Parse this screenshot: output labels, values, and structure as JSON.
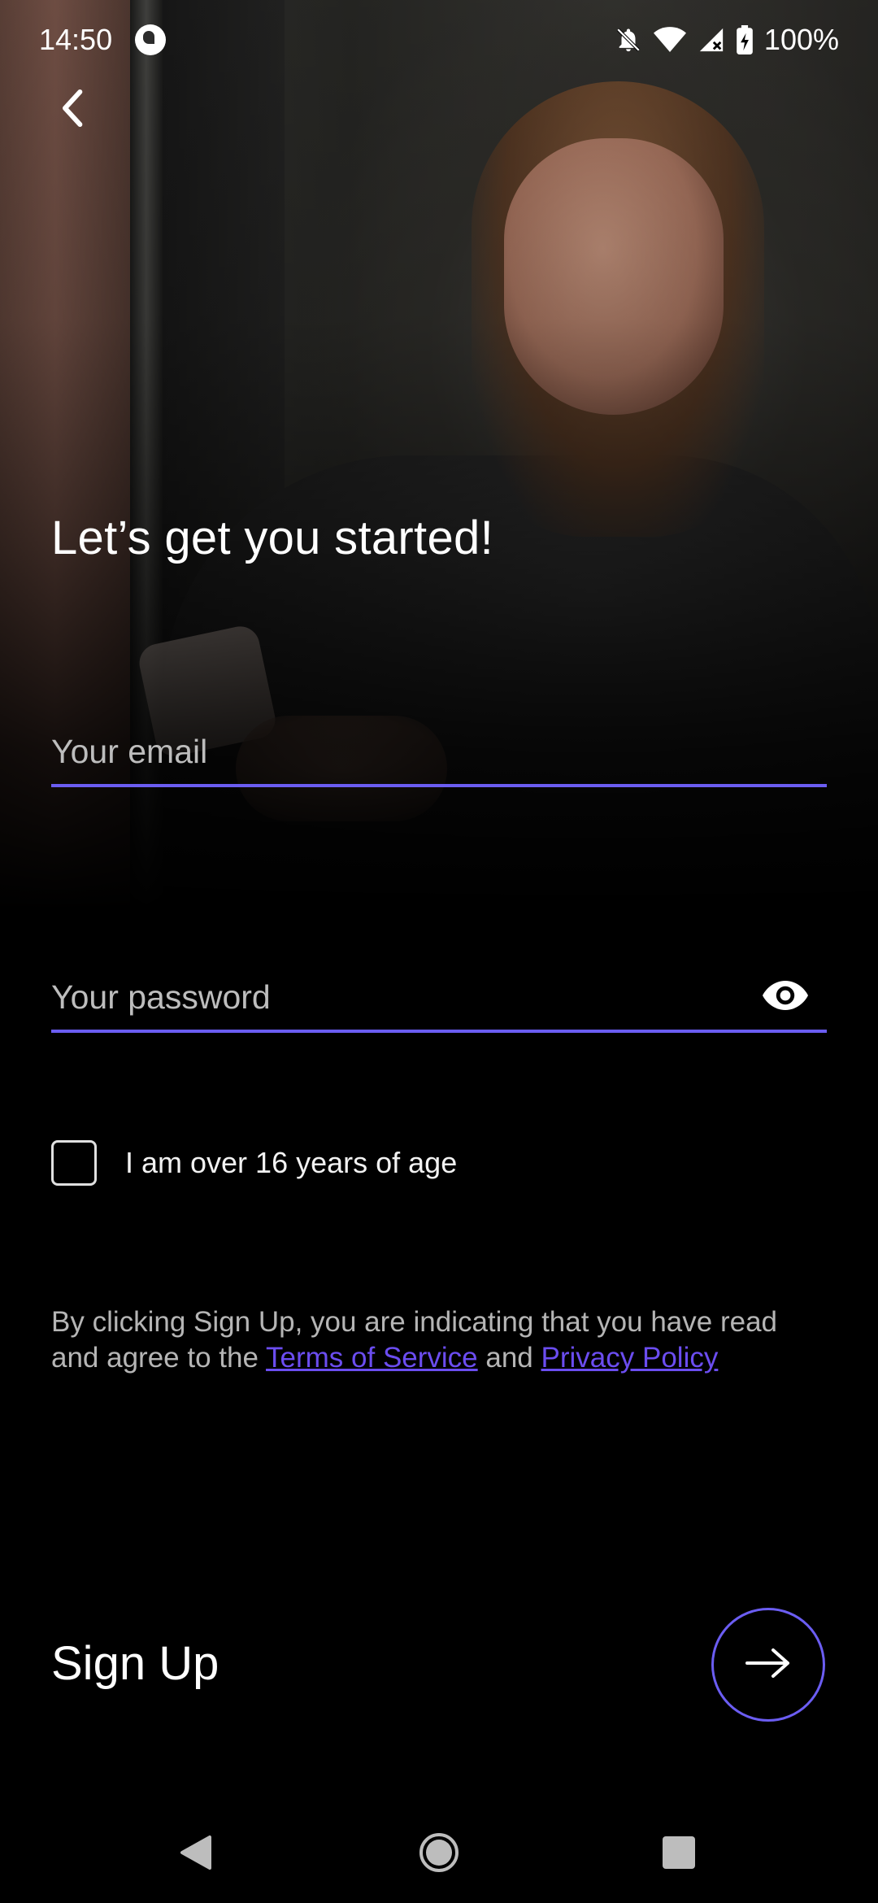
{
  "status_bar": {
    "time": "14:50",
    "battery": "100%",
    "icons": [
      "app-notification-icon",
      "bell-off-icon",
      "wifi-icon",
      "signal-icon",
      "battery-charging-icon"
    ]
  },
  "header": {
    "back_icon": "chevron-left-icon"
  },
  "headline": "Let’s get you started!",
  "form": {
    "email": {
      "placeholder": "Your email",
      "value": ""
    },
    "password": {
      "placeholder": "Your password",
      "value": "",
      "toggle_icon": "eye-icon"
    },
    "age_checkbox": {
      "label": "I am over 16 years of age",
      "checked": false
    }
  },
  "terms": {
    "prefix": "By clicking Sign Up, you are indicating that you have read and agree to the ",
    "terms_link": "Terms of Service",
    "joiner": " and ",
    "privacy_link": "Privacy Policy"
  },
  "signup": {
    "label": "Sign Up",
    "button_icon": "arrow-right-icon"
  },
  "nav_bar": {
    "back_icon": "triangle-back-icon",
    "home_icon": "circle-home-icon",
    "recents_icon": "square-recents-icon"
  },
  "colors": {
    "accent": "#6B5DF2",
    "link": "#6B4DF0",
    "background": "#000000",
    "muted_text": "#B5B5B5"
  }
}
